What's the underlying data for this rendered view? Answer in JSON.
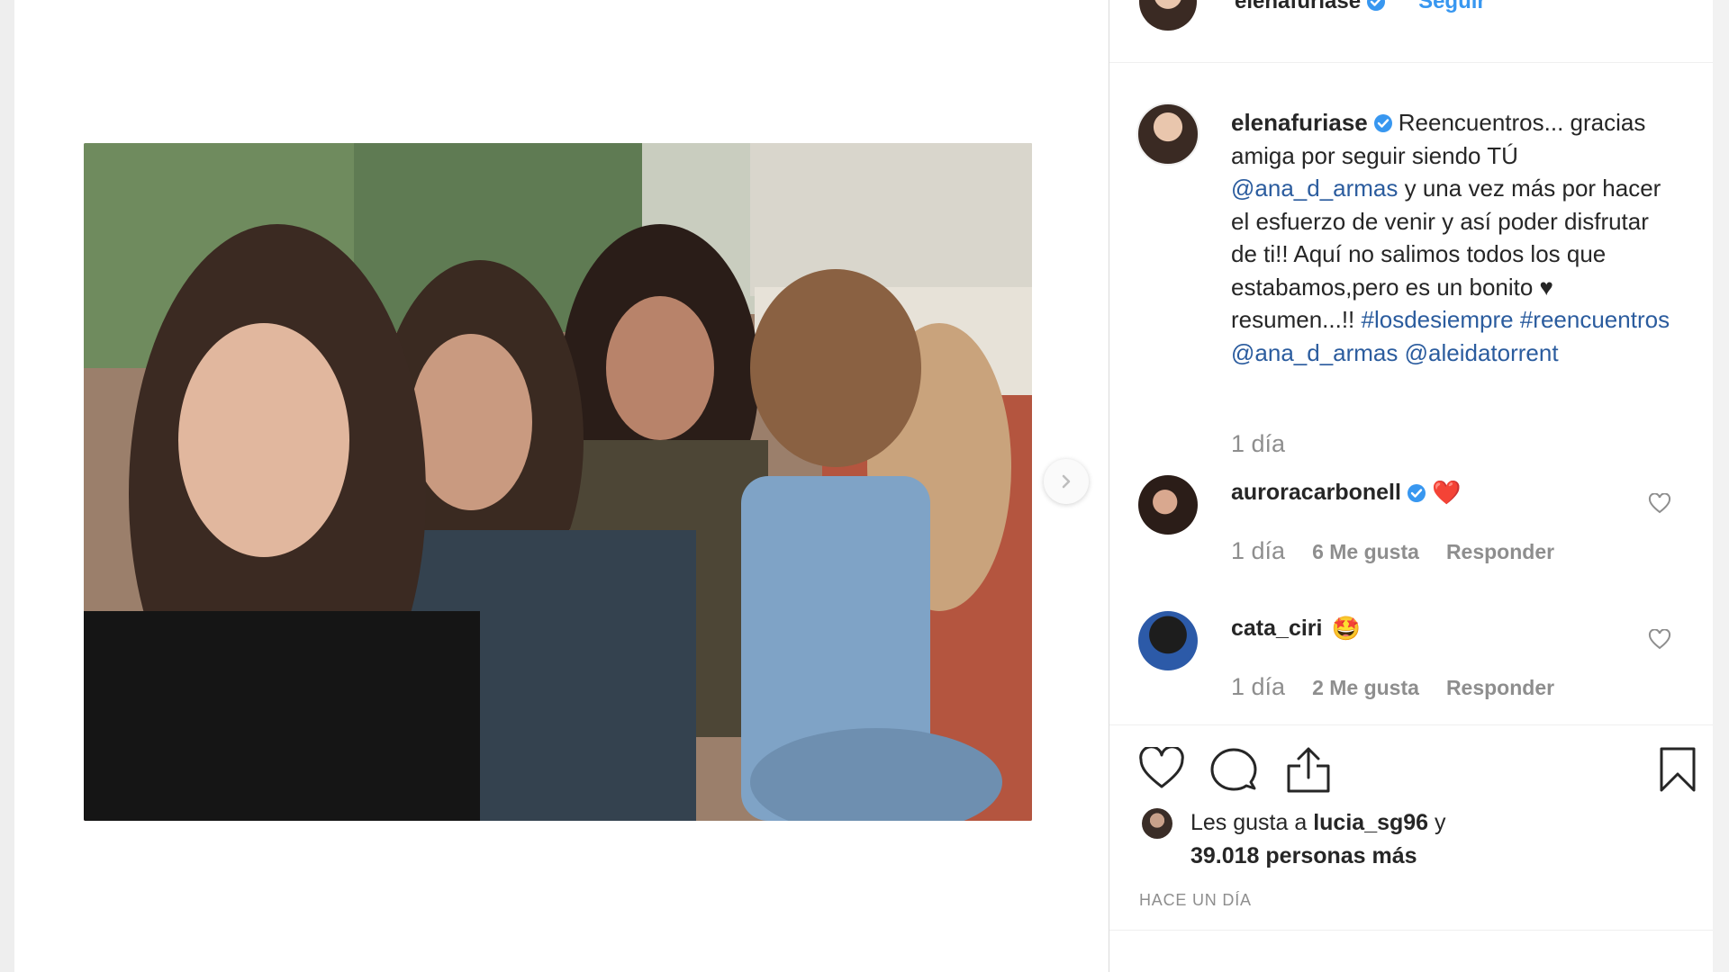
{
  "post": {
    "author": "elenafuriase",
    "follow_label": "Seguir",
    "caption": {
      "handle": "elenafuriase",
      "text_1": "Reencuentros... gracias amiga por seguir siendo TÚ",
      "mention_1": "@ana_d_armas",
      "text_2": "y una vez más por hacer el esfuerzo de venir y así poder disfrutar de ti!! Aquí no salimos todos los que estabamos,pero es un bonito ♥ resumen...!!",
      "hashtag_1": "#losdesiempre",
      "hashtag_2": "#reencuentros",
      "mention_2": "@ana_d_armas",
      "mention_3": "@aleidatorrent",
      "time": "1 día"
    }
  },
  "comments": [
    {
      "user": "auroracarbonell",
      "emoji": "❤️",
      "time": "1 día",
      "likes": "6 Me gusta",
      "reply": "Responder"
    },
    {
      "user": "cata_ciri",
      "emoji": "🤩",
      "time": "1 día",
      "likes": "2 Me gusta",
      "reply": "Responder"
    }
  ],
  "likes": {
    "prefix": "Les gusta a",
    "user": "lucia_sg96",
    "joiner": "y",
    "others": "39.018 personas más"
  },
  "timestamp": "HACE UN DÍA",
  "colors": {
    "link": "#2b5c9e",
    "follow": "#3897f0",
    "verified": "#3897f0",
    "muted": "#8e8e8e",
    "text": "#262626"
  }
}
